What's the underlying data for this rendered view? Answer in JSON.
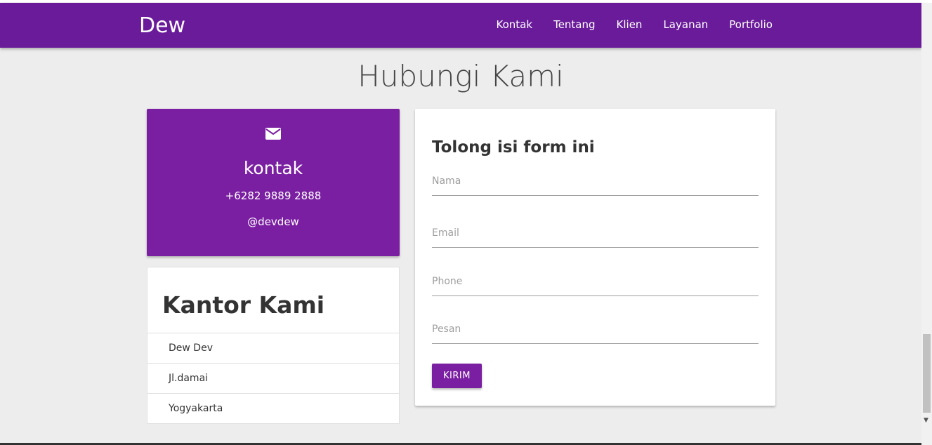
{
  "navbar": {
    "brand": "Dew",
    "links": [
      "Kontak",
      "Tentang",
      "Klien",
      "Layanan",
      "Portfolio"
    ]
  },
  "page_title": "Hubungi Kami",
  "contact_card": {
    "icon": "mail-icon",
    "title": "kontak",
    "phone": "+6282 9889 2888",
    "social": "@devdew"
  },
  "office": {
    "title": "Kantor Kami",
    "items": [
      "Dew Dev",
      "Jl.damai",
      "Yogyakarta"
    ]
  },
  "form": {
    "title": "Tolong isi form ini",
    "fields": [
      {
        "placeholder": "Nama",
        "value": ""
      },
      {
        "placeholder": "Email",
        "value": ""
      },
      {
        "placeholder": "Phone",
        "value": ""
      },
      {
        "placeholder": "Pesan",
        "value": ""
      }
    ],
    "submit_label": "KIRIM"
  },
  "colors": {
    "navbar": "#6a1b9a",
    "accent": "#7b1fa2",
    "background": "#ededed"
  }
}
